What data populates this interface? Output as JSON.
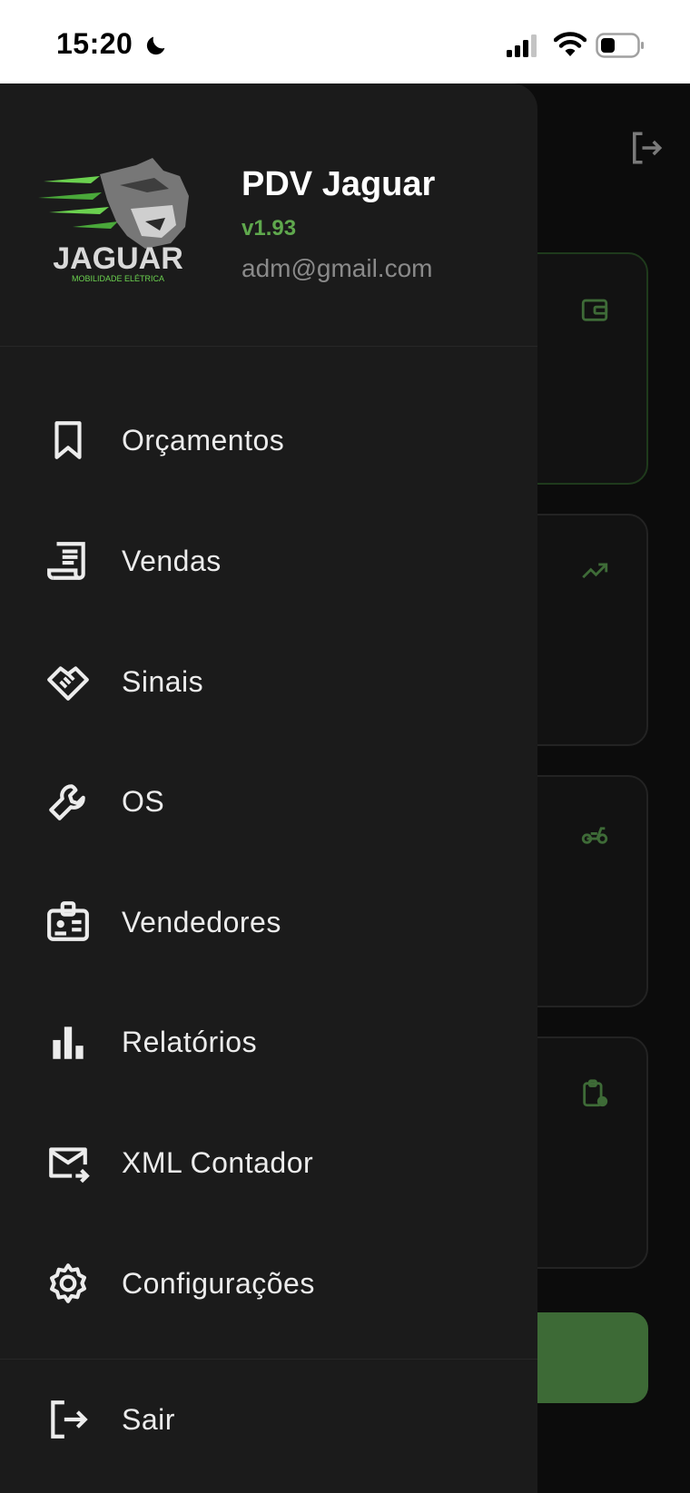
{
  "status_bar": {
    "time": "15:20",
    "icons": [
      "moon-icon",
      "signal-icon",
      "wifi-icon",
      "battery-icon"
    ]
  },
  "drawer": {
    "logo_icon": "jaguar-logo",
    "logo_text": "JAGUAR",
    "logo_subtext": "MOBILIDADE ELÉTRICA",
    "app_name": "PDV Jaguar",
    "version": "v1.93",
    "email": "adm@gmail.com",
    "menu": [
      {
        "label": "Orçamentos",
        "icon": "bookmark-icon"
      },
      {
        "label": "Vendas",
        "icon": "receipt-icon"
      },
      {
        "label": "Sinais",
        "icon": "handshake-icon"
      },
      {
        "label": "OS",
        "icon": "wrench-icon"
      },
      {
        "label": "Vendedores",
        "icon": "badge-icon"
      },
      {
        "label": "Relatórios",
        "icon": "bar-chart-icon"
      },
      {
        "label": "XML Contador",
        "icon": "mail-send-icon"
      },
      {
        "label": "Configurações",
        "icon": "gear-icon"
      }
    ],
    "logout": {
      "label": "Sair",
      "icon": "logout-icon"
    }
  },
  "background": {
    "card_icons": [
      "wallet-icon",
      "trending-up-icon",
      "scooter-icon",
      "clipboard-clock-icon"
    ]
  },
  "colors": {
    "accent": "#5fa84d",
    "drawer_bg": "#1b1b1b",
    "text": "#ececec",
    "muted": "#8a8a8a",
    "button": "#3d6a36"
  }
}
